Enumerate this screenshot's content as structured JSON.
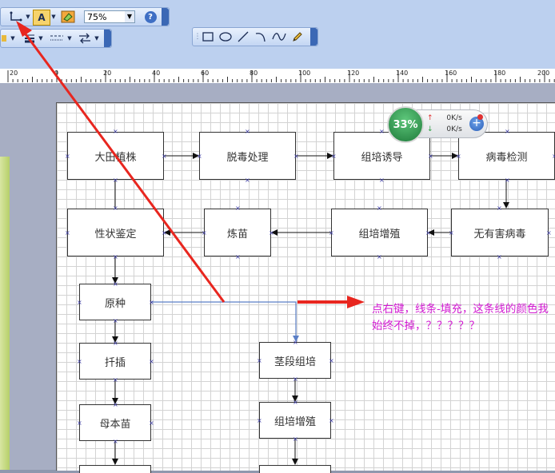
{
  "toolbar": {
    "font_color_label": "A",
    "zoom_value": "75%",
    "help_label": "?"
  },
  "ruler": {
    "labels": [
      "20",
      "0",
      "20",
      "40",
      "60",
      "80",
      "100",
      "120",
      "140",
      "160",
      "180",
      "200"
    ]
  },
  "flowchart": {
    "nodes": {
      "n1": "大田植株",
      "n2": "脱毒处理",
      "n3": "组培诱导",
      "n4": "病毒检测",
      "n5": "性状鉴定",
      "n6": "炼苗",
      "n7": "组培增殖",
      "n8": "无有害病毒",
      "n9": "原种",
      "n10": "扦插",
      "n11": "母本苗",
      "n12": "茎段组培",
      "n13": "组培增殖"
    }
  },
  "speed_widget": {
    "percent": "33%",
    "upload": "0K/s",
    "download": "0K/s",
    "upload_arrow": "↑",
    "download_arrow": "↓",
    "plus": "+"
  },
  "annotation": {
    "text": "点右键，线条-填充，这条线的颜色我始终不掉，？？？？？"
  },
  "colors": {
    "annotation_text": "#d21ad2",
    "arrow": "#e8261f",
    "connector": "#5b7fc6"
  }
}
